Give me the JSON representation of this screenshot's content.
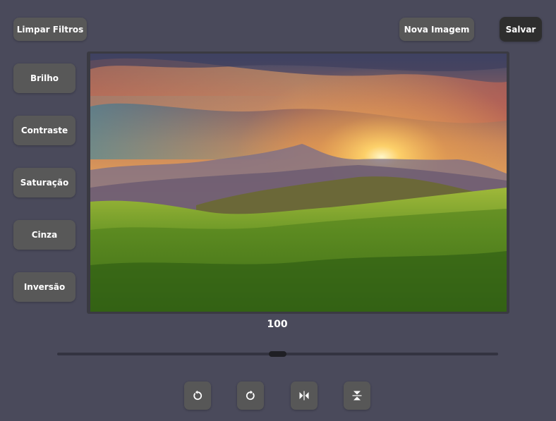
{
  "toolbar": {
    "clear_label": "Limpar Filtros",
    "new_image_label": "Nova Imagem",
    "save_label": "Salvar"
  },
  "filters": [
    {
      "label": "Brilho"
    },
    {
      "label": "Contraste"
    },
    {
      "label": "Saturação"
    },
    {
      "label": "Cinza"
    },
    {
      "label": "Inversão"
    }
  ],
  "slider": {
    "value": "100",
    "min": 0,
    "max": 200,
    "current": 100
  },
  "actions": [
    {
      "icon": "rotate-left-icon"
    },
    {
      "icon": "rotate-right-icon"
    },
    {
      "icon": "flip-horizontal-icon"
    },
    {
      "icon": "flip-vertical-icon"
    }
  ],
  "colors": {
    "background": "#4a4a5b",
    "button": "#585858",
    "save_button": "#2e2e2e",
    "slider_track": "#333340",
    "slider_thumb": "#1f1f24"
  }
}
